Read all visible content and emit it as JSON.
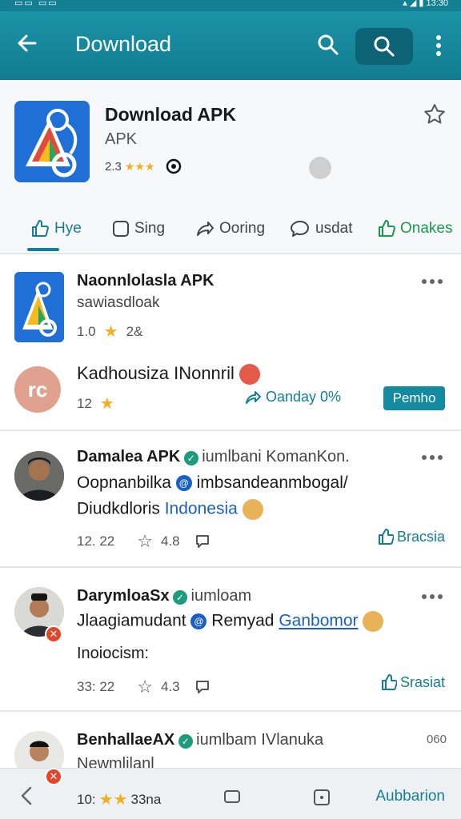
{
  "colors": {
    "primary": "#147f93",
    "appbar": "#1b93a8",
    "accent_green": "#1a9a4e",
    "link_blue": "#1a5fc4",
    "star": "#f2b01e"
  },
  "appbar": {
    "title": "Download"
  },
  "app": {
    "name": "Download APK",
    "subtitle": "APK",
    "rating_text": "2.3"
  },
  "tabs": [
    {
      "label": "Hye",
      "icon": "thumbs-up-icon"
    },
    {
      "label": "Sing",
      "icon": "square-icon"
    },
    {
      "label": "Ooring",
      "icon": "share-icon"
    },
    {
      "label": "usdat",
      "icon": "chat-icon"
    },
    {
      "label": "Onakes",
      "icon": "thumbs-up-icon"
    }
  ],
  "post1": {
    "name": "Naonnlolasla APK",
    "sub": "sawiasdloak",
    "rating": "1.0",
    "rating_extra": "2&",
    "line2_name": "Kadhousiza INonnril",
    "line2_avatar": "rc",
    "count": "12",
    "share_label": "Oanday 0%",
    "button": "Pemho"
  },
  "post2": {
    "name": "Damalea APK",
    "tag": "iumlbani KomanKon.",
    "line1_a": "Oopnanbilka",
    "line1_b": "imbsandeanmbogal/",
    "line2_a": "Diudkdloris",
    "line2_link": "Indonesia",
    "time": "12. 22",
    "likes": "4.8",
    "action": "Bracsia"
  },
  "post3": {
    "name": "DarymloaSx",
    "tag": "iumloam",
    "line1_a": "Jlaagiamudant",
    "line1_b": "Remyad",
    "line1_link": "Ganbomor",
    "line2": "Inoiocism:",
    "time": "33: 22",
    "likes": "4.3",
    "action": "Srasiat"
  },
  "post4": {
    "name": "BenhallaeAX",
    "tag": "iumlbam IVlanuka",
    "right_num": "060",
    "line1": "Newmlilanl"
  },
  "bottombar": {
    "rating": "10:",
    "rating_extra": "33na",
    "action": "Aubbarion"
  }
}
